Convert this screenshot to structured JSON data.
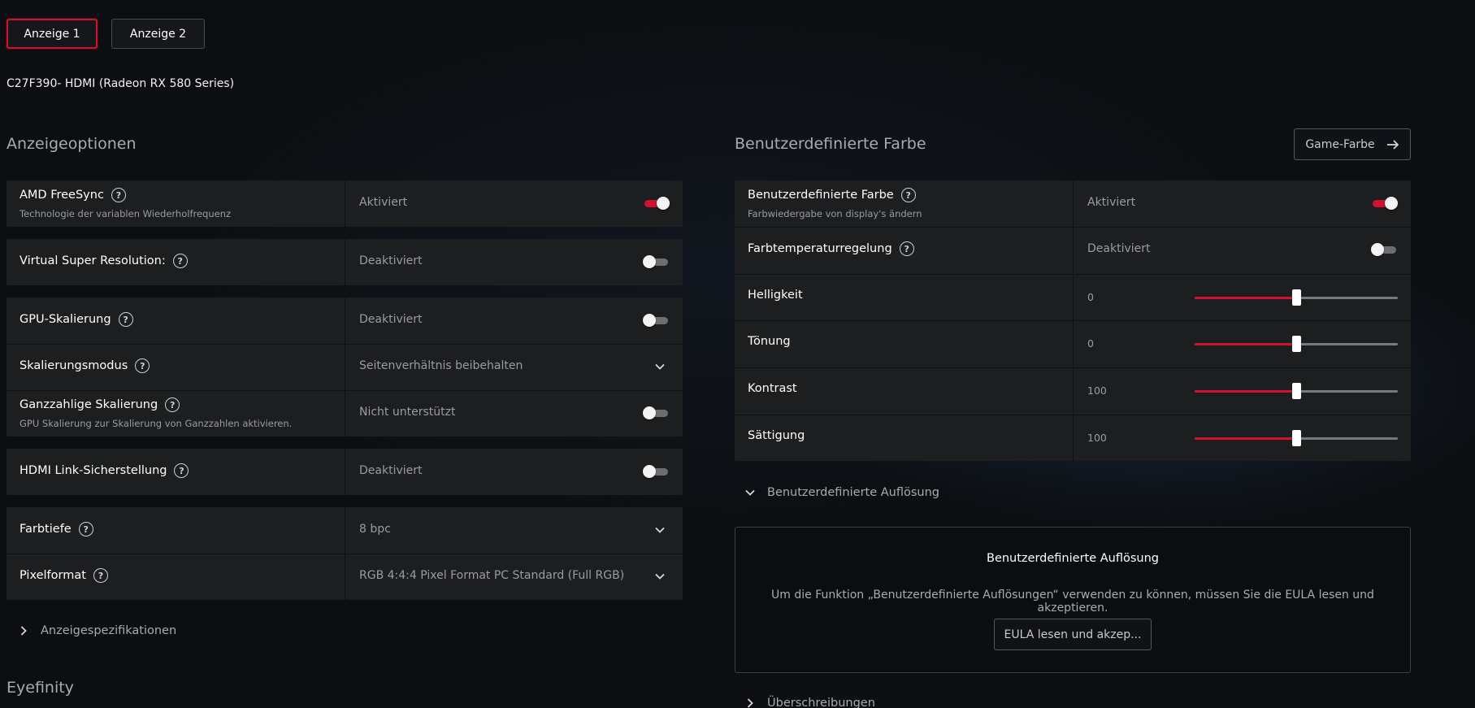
{
  "tabs": [
    {
      "label": "Anzeige 1",
      "active": true
    },
    {
      "label": "Anzeige 2",
      "active": false
    }
  ],
  "monitor": {
    "name": "C27F390- HDMI (Radeon RX 580 Series)"
  },
  "display_options": {
    "title": "Anzeigeoptionen",
    "freesync": {
      "label": "AMD FreeSync",
      "sub": "Technologie der variablen Wiederholfrequenz",
      "value": "Aktiviert",
      "enabled": true
    },
    "vsr": {
      "label": "Virtual Super Resolution:",
      "value": "Deaktiviert",
      "enabled": false
    },
    "gpu_scaling": {
      "label": "GPU-Skalierung",
      "value": "Deaktiviert",
      "enabled": false
    },
    "scaling_mode": {
      "label": "Skalierungsmodus",
      "value": "Seitenverhältnis beibehalten"
    },
    "integer_scaling": {
      "label": "Ganzzahlige Skalierung",
      "sub": "GPU Skalierung zur Skalierung von Ganzzahlen aktivieren.",
      "value": "Nicht unterstützt",
      "enabled": false
    },
    "hdmi_link": {
      "label": "HDMI Link-Sicherstellung",
      "value": "Deaktiviert",
      "enabled": false
    },
    "color_depth": {
      "label": "Farbtiefe",
      "value": "8 bpc"
    },
    "pixel_format": {
      "label": "Pixelformat",
      "value": "RGB 4:4:4 Pixel Format PC Standard (Full RGB)"
    }
  },
  "display_specs": {
    "label": "Anzeigespezifikationen"
  },
  "eyefinity": {
    "title": "Eyefinity"
  },
  "custom_color": {
    "title": "Benutzerdefinierte Farbe",
    "game_color_button": "Game-Farbe",
    "main": {
      "label": "Benutzerdefinierte Farbe",
      "sub": "Farbwiedergabe von display's ändern",
      "value": "Aktiviert",
      "enabled": true
    },
    "temperature": {
      "label": "Farbtemperaturregelung",
      "value": "Deaktiviert",
      "enabled": false
    },
    "sliders": [
      {
        "label": "Helligkeit",
        "value": "0",
        "level": 0.5
      },
      {
        "label": "Tönung",
        "value": "0",
        "level": 0.5
      },
      {
        "label": "Kontrast",
        "value": "100",
        "level": 0.5
      },
      {
        "label": "Sättigung",
        "value": "100",
        "level": 0.5
      }
    ]
  },
  "custom_resolution": {
    "expander_label": "Benutzerdefinierte Auflösung",
    "box_title": "Benutzerdefinierte Auflösung",
    "box_text": "Um die Funktion „Benutzerdefinierte Auflösungen“ verwenden zu können, müssen Sie die EULA lesen und akzeptieren.",
    "eula_button": "EULA lesen und akzep..."
  },
  "overrides": {
    "label": "Überschreibungen"
  },
  "colors": {
    "accent": "#d0122e",
    "panel": "#1d1e20",
    "background": "#0c0e12"
  }
}
